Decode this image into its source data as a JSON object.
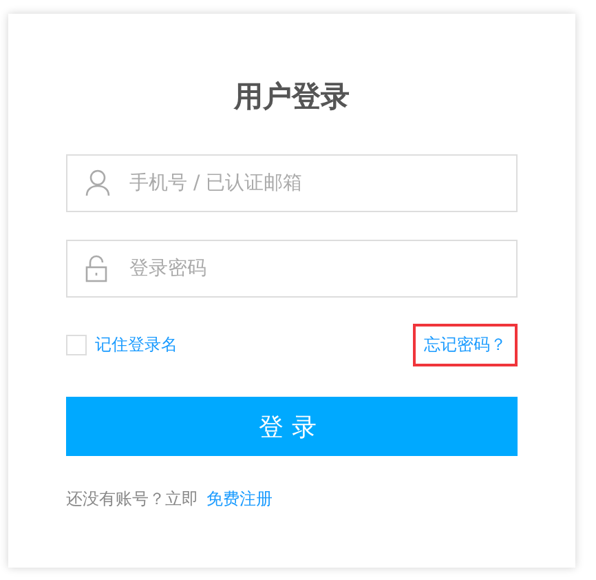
{
  "title": "用户登录",
  "fields": [
    {
      "kind": "user",
      "placeholder": "手机号 / 已认证邮箱"
    },
    {
      "kind": "password",
      "placeholder": "登录密码"
    }
  ],
  "remember": {
    "label": "记住登录名",
    "checked": false
  },
  "forgot": {
    "label": "忘记密码？",
    "highlighted": true
  },
  "submit": "登录",
  "footer": {
    "text": "还没有账号？立即",
    "link": "免费注册"
  }
}
